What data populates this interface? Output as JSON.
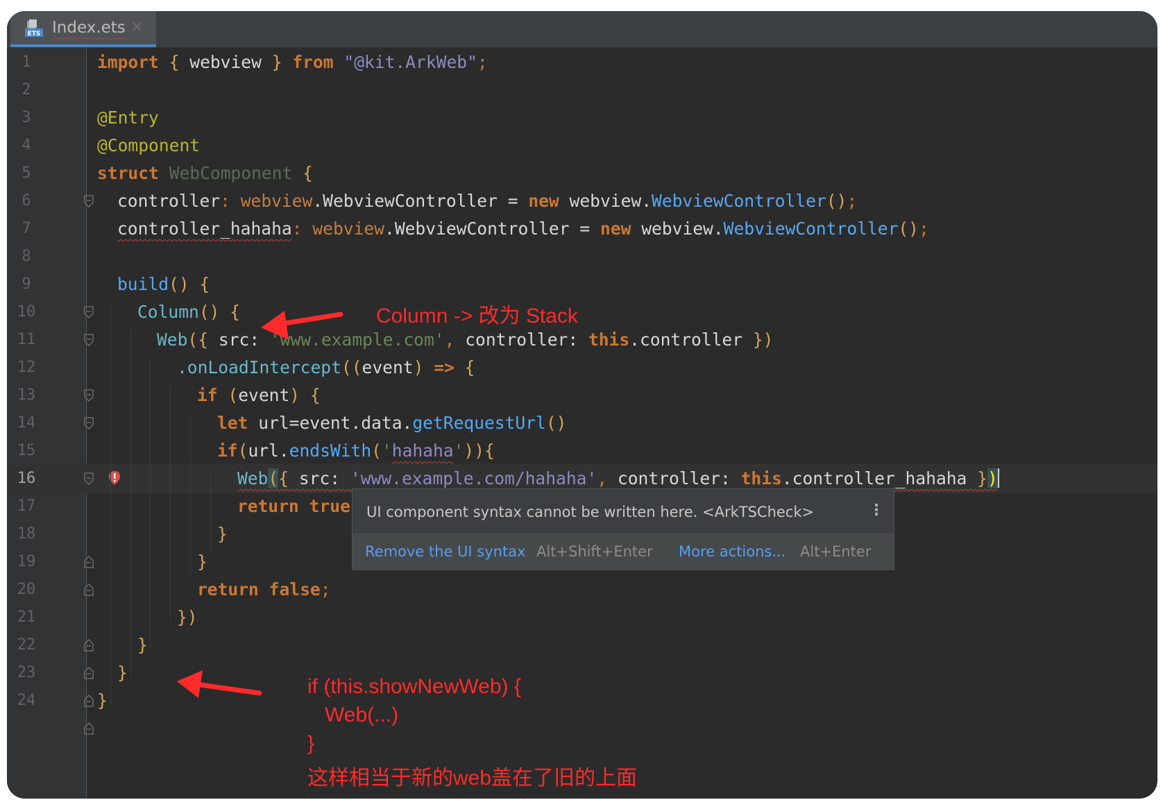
{
  "tab": {
    "title": "Index.ets",
    "close": "×",
    "icon": "ets-file-icon"
  },
  "line_numbers": [
    "1",
    "2",
    "3",
    "4",
    "5",
    "6",
    "7",
    "8",
    "9",
    "10",
    "11",
    "12",
    "13",
    "14",
    "15",
    "16",
    "17",
    "18",
    "19",
    "20",
    "21",
    "22",
    "23",
    "24"
  ],
  "current_line": "16",
  "code": {
    "l1": {
      "kw": "import",
      "b1": " { ",
      "id": "webview",
      "b2": " } ",
      "from": "from",
      "sp": " ",
      "str": "\"@kit.ArkWeb\"",
      "end": ";"
    },
    "l3": "@Entry",
    "l4": "@Component",
    "l5": {
      "kw": "struct",
      "sp": " ",
      "name": "WebComponent",
      "br": " {"
    },
    "l6": {
      "field": "controller",
      "colon": ": ",
      "ns": "webview",
      "dot": ".",
      "type": "WebviewController",
      "eq": " = ",
      "new": "new",
      "sp": " ",
      "ns2": "webview.",
      "cls": "WebviewController",
      "par": "()",
      "end": ";"
    },
    "l7": {
      "field": "controller_hahaha",
      "colon": ": ",
      "ns": "webview",
      "dot": ".",
      "type": "WebviewController",
      "eq": " = ",
      "new": "new",
      "sp": " ",
      "ns2": "webview.",
      "cls": "WebviewController",
      "par": "()",
      "end": ";"
    },
    "l9": {
      "fn": "build",
      "par": "()",
      "br": " {"
    },
    "l10": {
      "fn": "Column",
      "par": "()",
      "br": " {"
    },
    "l11": {
      "fn": "Web",
      "b1": "({ ",
      "k1": "src",
      "c1": ": ",
      "str": "'www.example.com'",
      "comma": ", ",
      "k2": "controller",
      "c2": ": ",
      "this": "this",
      "mem": ".controller",
      "b2": " })"
    },
    "l12": {
      "fn": ".onLoadIntercept",
      "p1": "((",
      "arg": "event",
      "p2": ") ",
      "arrow": "=>",
      "br": " {"
    },
    "l13": {
      "kw": "if",
      "p1": " (",
      "arg": "event",
      "p2": ")",
      "br": " {"
    },
    "l14": {
      "kw": "let",
      "rest": " url=event.data.",
      "fn": "getRequestUrl",
      "par": "()"
    },
    "l15": {
      "kw": "if",
      "p1": "(",
      "id": "url.",
      "fn": "endsWith",
      "p2": "(",
      "str1": "'",
      "str2": "hahaha",
      "str3": "'",
      "p3": ")){"
    },
    "l16": {
      "fn": "Web",
      "b1": "(",
      "b2": "{ ",
      "k1": "src",
      "c1": ": ",
      "str": "'www.example.com/hahaha'",
      "comma": ", ",
      "k2": "controller",
      "c2": ": ",
      "this": "this",
      "mem": ".controller_hahaha",
      "b3": " }",
      "b4": ")"
    },
    "l17": {
      "kw": "return",
      "sp": " ",
      "val": "true"
    },
    "l18": "}",
    "l19": "}",
    "l20": {
      "kw": "return",
      "sp": " ",
      "val": "false",
      "end": ";"
    },
    "l21": "})",
    "l22": "}",
    "l23": "}",
    "l24": "}"
  },
  "popup": {
    "message": "UI component syntax cannot be written here. <ArkTSCheck>",
    "menu": "⋮",
    "action1": "Remove the UI syntax",
    "action1_key": "Alt+Shift+Enter",
    "action2": "More actions...",
    "action2_key": "Alt+Enter"
  },
  "annotations": {
    "note1": "Column -> 改为 Stack",
    "note2_l1": "if (this.showNewWeb) {",
    "note2_l2": "   Web(...)",
    "note2_l3": "}",
    "note2_l4": "这样相当于新的web盖在了旧的上面"
  },
  "colors": {
    "annotation": "#ff2b2b",
    "background": "#2b2b2b",
    "keyword": "#cc7832",
    "string": "#6a8759",
    "function": "#56a8f5"
  }
}
